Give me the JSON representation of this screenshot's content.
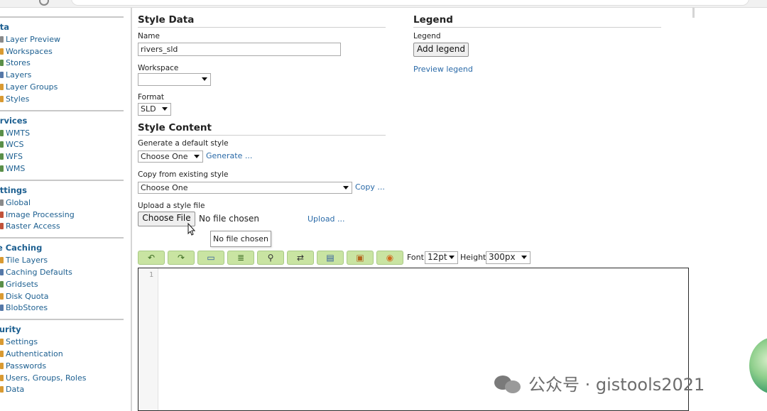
{
  "browser": {
    "url_fragment": "· · · · · · · · · · · · · · · · · · · · · · · · · · · · · · · · · · · · · · · · · · · · · · · ·"
  },
  "sidebar": {
    "sections": [
      {
        "title": "ata",
        "items": [
          "Layer Preview",
          "Workspaces",
          "Stores",
          "Layers",
          "Layer Groups",
          "Styles"
        ]
      },
      {
        "title": "ervices",
        "items": [
          "WMTS",
          "WCS",
          "WFS",
          "WMS"
        ]
      },
      {
        "title": "ettings",
        "items": [
          "Global",
          "Image Processing",
          "Raster Access"
        ]
      },
      {
        "title": "le Caching",
        "items": [
          "Tile Layers",
          "Caching Defaults",
          "Gridsets",
          "Disk Quota",
          "BlobStores"
        ]
      },
      {
        "title": "curity",
        "items": [
          "Settings",
          "Authentication",
          "Passwords",
          "Users, Groups, Roles",
          "Data"
        ]
      }
    ]
  },
  "style_data": {
    "heading": "Style Data",
    "name_label": "Name",
    "name_value": "rivers_sld",
    "workspace_label": "Workspace",
    "workspace_value": "",
    "format_label": "Format",
    "format_value": "SLD"
  },
  "legend": {
    "heading": "Legend",
    "label": "Legend",
    "add_button": "Add legend",
    "preview_link": "Preview legend"
  },
  "style_content": {
    "heading": "Style Content",
    "generate_label": "Generate a default style",
    "generate_select": "Choose One",
    "generate_link": "Generate ...",
    "copy_label": "Copy from existing style",
    "copy_select": "Choose One",
    "copy_link": "Copy ...",
    "upload_label": "Upload a style file",
    "choose_file_button": "Choose File",
    "no_file_text": "No file chosen",
    "upload_link": "Upload ...",
    "tooltip": "No file chosen"
  },
  "toolbar": {
    "icons": [
      "undo-icon",
      "redo-icon",
      "search-icon",
      "indent-icon",
      "find-icon",
      "replace-icon",
      "format-icon",
      "image-icon",
      "color-icon"
    ],
    "font_label": "Font",
    "font_value": "12pt",
    "height_label": "Height",
    "height_value": "300px",
    "accent": "#c9e4a2"
  },
  "editor": {
    "line_number": "1"
  },
  "watermark": {
    "text": "公众号 · gistools2021"
  }
}
